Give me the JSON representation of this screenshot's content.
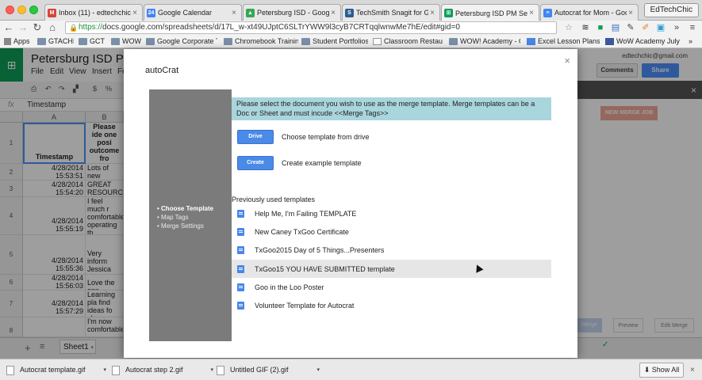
{
  "browser": {
    "tabs": [
      {
        "title": "Inbox (11) - edtechchic@",
        "fav": "M",
        "color": "#d44638"
      },
      {
        "title": "Google Calendar",
        "fav": "24",
        "color": "#4285f4"
      },
      {
        "title": "Petersburg ISD - Google D",
        "fav": "▲",
        "color": "#34a853"
      },
      {
        "title": "TechSmith Snagit for Goog",
        "fav": "S",
        "color": "#2a5d8f"
      },
      {
        "title": "Petersburg ISD PM Sessio",
        "fav": "⊞",
        "color": "#0f9d58"
      },
      {
        "title": "Autocrat for Mom - Googl",
        "fav": "≡",
        "color": "#4285f4"
      }
    ],
    "profile_name": "EdTechChic",
    "url_scheme": "https://",
    "url_rest": "docs.google.com/spreadsheets/d/17L_w-xt49UJptC6SLTrYWW9l3cyB7CRTqqlwnwMe7hE/edit#gid=0",
    "bookmarks": [
      "Apps",
      "GTACHI",
      "GCT",
      "WOW",
      "Google Corporate Tr",
      "Chromebook Training",
      "Student Portfolios",
      "Classroom Restaura",
      "WOW! Academy - Go",
      "Excel Lesson Plans f",
      "WoW Academy July"
    ]
  },
  "sheet": {
    "title": "Petersburg ISD PM Se",
    "menu": [
      "File",
      "Edit",
      "View",
      "Insert",
      "Fo"
    ],
    "user_email": "edtechchic@gmail.com",
    "comments_label": "Comments",
    "share_label": "Share",
    "fx_value": "Timestamp",
    "col_a": "A",
    "col_b": "B",
    "rows": [
      {
        "num": "1",
        "a": "Timestamp",
        "b": "Please ide one posi outcome fro session fo persona"
      },
      {
        "num": "2",
        "a": "4/28/2014 15:53:51",
        "b": "Lots of new information!"
      },
      {
        "num": "3",
        "a": "4/28/2014 15:54:20",
        "b": "GREAT RESOURCE"
      },
      {
        "num": "4",
        "a": "4/28/2014 15:55:19",
        "b": "I feel much r comfortable operating th Chromebook"
      },
      {
        "num": "5",
        "a": "4/28/2014 15:55:36",
        "b": "Very inform Jessica spok our level."
      },
      {
        "num": "6",
        "a": "4/28/2014 15:56:03",
        "b": "Love the app"
      },
      {
        "num": "7",
        "a": "4/28/2014 15:57:29",
        "b": "Learning pla find ideas fo classroom u"
      },
      {
        "num": "8",
        "a": "",
        "b": "I'm now comfortable"
      }
    ],
    "sheet_tab": "Sheet1"
  },
  "sidepanel": {
    "new_merge_label": "NEW MERGE JOB",
    "footer": [
      "Merge",
      "Preview",
      "Edit Merge"
    ]
  },
  "modal": {
    "title": "autoCrat",
    "steps": [
      "Choose Template",
      "Map Tags",
      "Merge Settings"
    ],
    "banner": "Please select the document you wish to use as the merge template. Merge templates can be a Doc or Sheet and must incude <<Merge Tags>>",
    "drive_button": "Drive",
    "drive_label": "Choose template from drive",
    "create_button": "Create",
    "create_label": "Create example template",
    "previous_heading": "Previously used templates",
    "templates": [
      "Help Me, I'm Failing TEMPLATE",
      "New Caney TxGoo Certificate",
      "TxGoo2015 Day of 5 Things...Presenters",
      "TxGoo15 YOU HAVE SUBMITTED template",
      "Goo in the Loo Poster",
      "Volunteer Template for Autocrat"
    ],
    "highlighted_index": 3
  },
  "downloads": {
    "items": [
      "Autocrat template.gif",
      "Autocrat step 2.gif",
      "Untitled GIF (2).gif"
    ],
    "show_all": "Show All"
  }
}
